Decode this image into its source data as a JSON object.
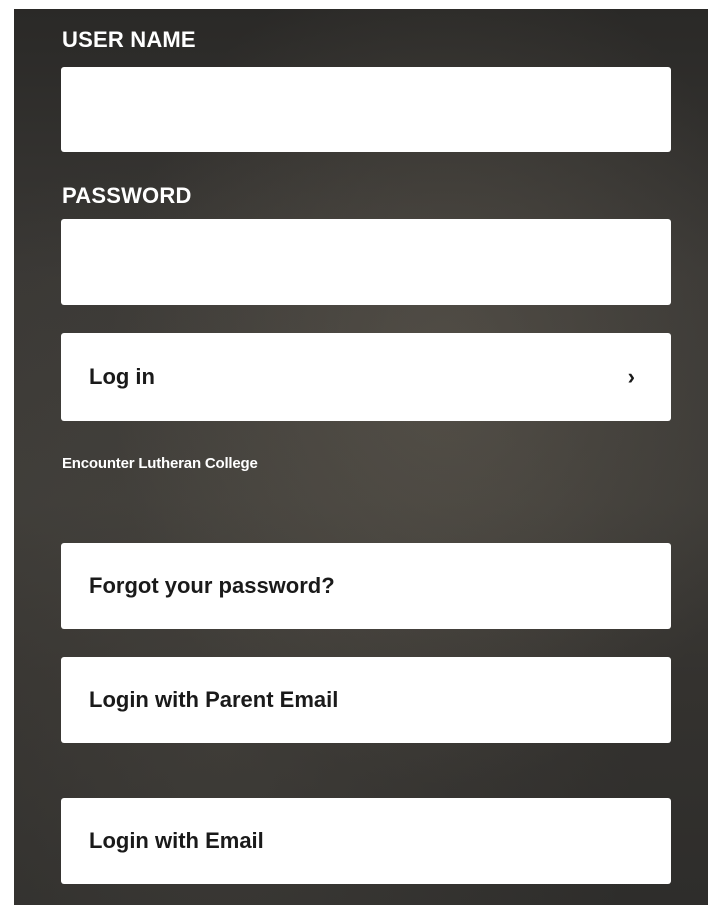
{
  "form": {
    "username_label": "USER NAME",
    "username_value": "",
    "password_label": "PASSWORD",
    "password_value": "",
    "login_label": "Log in",
    "login_chevron": "›"
  },
  "school": {
    "name": "Encounter Lutheran College"
  },
  "links": {
    "forgot_password": "Forgot your password?",
    "parent_email_login": "Login with Parent Email",
    "email_login": "Login with Email"
  },
  "colors": {
    "panel_background": "#3a3835",
    "text_light": "#ffffff",
    "button_background": "#ffffff",
    "button_text": "#1a1a1a"
  },
  "icons": {
    "login_arrow": "chevron-right-icon"
  }
}
